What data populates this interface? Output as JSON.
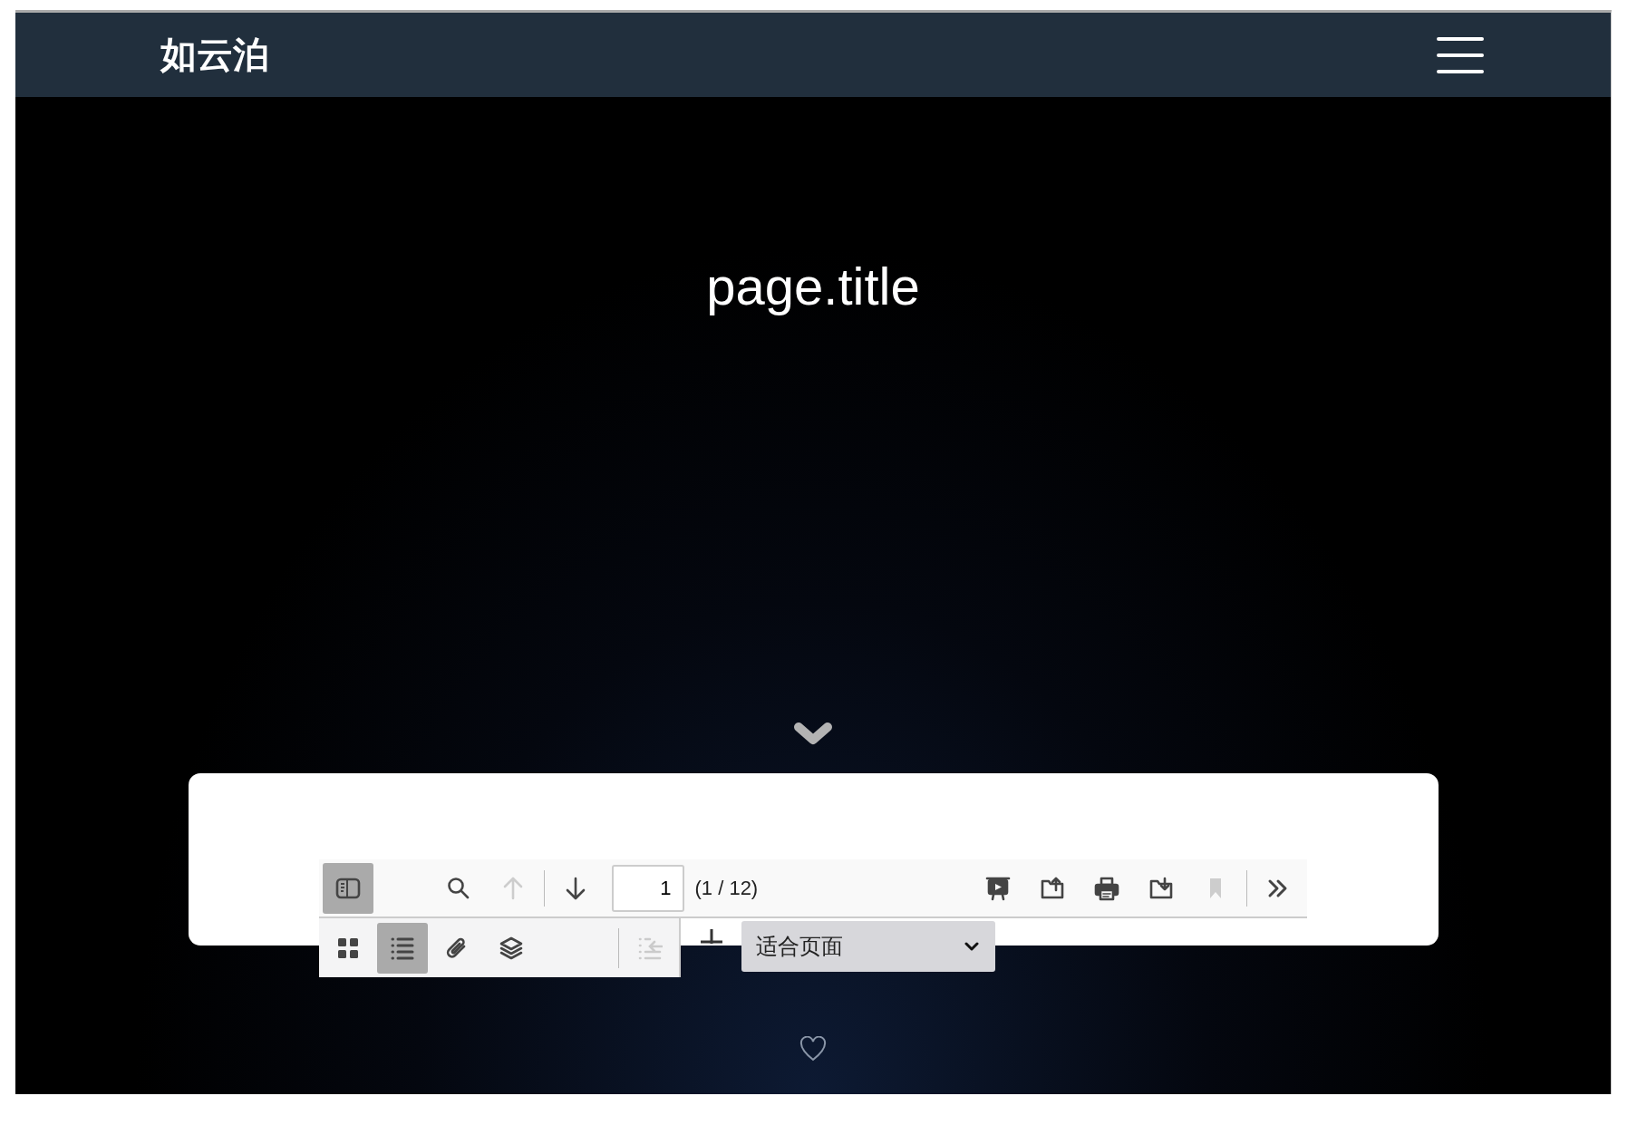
{
  "header": {
    "logo": "如云泊"
  },
  "hero": {
    "title": "page.title"
  },
  "viewer": {
    "toolbar": {
      "sidebar_toggle": {
        "selected": true
      },
      "buttons_left": [
        {
          "kind": "search",
          "disabled": false
        },
        {
          "kind": "up",
          "disabled": true
        },
        {
          "kind": "down",
          "disabled": false
        }
      ],
      "page_number": "1",
      "page_count": "(1 / 12)",
      "buttons_right": [
        {
          "kind": "presentation",
          "disabled": false
        },
        {
          "kind": "open",
          "disabled": false
        },
        {
          "kind": "print",
          "disabled": false
        },
        {
          "kind": "download",
          "disabled": false
        },
        {
          "kind": "bookmark",
          "disabled": true
        },
        {
          "kind": "more",
          "disabled": false
        }
      ]
    },
    "sidebar_views": [
      {
        "kind": "thumbnails",
        "selected": false
      },
      {
        "kind": "outline",
        "selected": true
      },
      {
        "kind": "attachments",
        "selected": false
      },
      {
        "kind": "layers",
        "selected": false
      }
    ],
    "collapse_button": {
      "disabled": true
    },
    "zoom_select": {
      "value": "适合页面"
    }
  }
}
